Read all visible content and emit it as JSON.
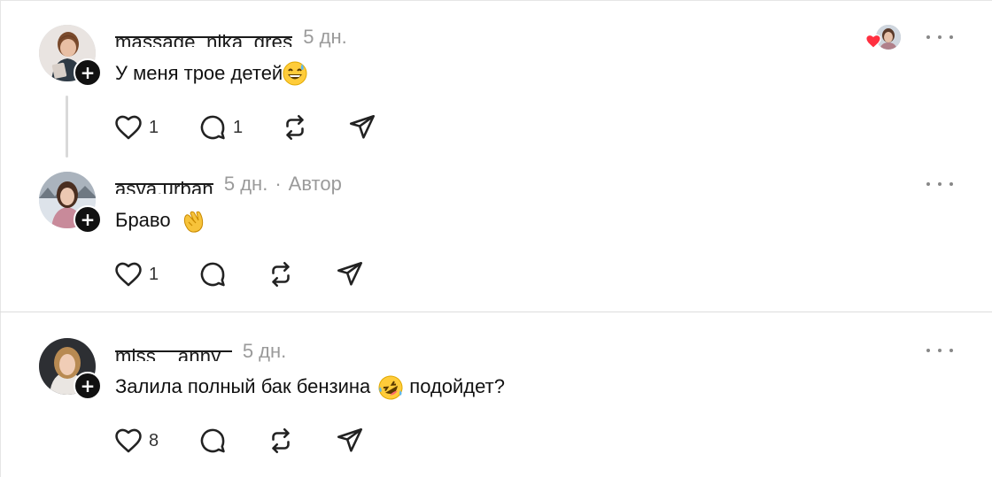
{
  "comments": [
    {
      "username": "massage_nika_gres",
      "time": "5 дн.",
      "author_label": "",
      "text": "У меня трое детей",
      "emoji": "grinning-sweat",
      "text_after": "",
      "likes": "1",
      "replies": "1",
      "liked_by_author": true
    },
    {
      "username": "asya.urban",
      "time": "5 дн.",
      "author_label": "Автор",
      "text": "Браво",
      "emoji": "clapping-hands",
      "text_after": "",
      "likes": "1",
      "replies": ""
    },
    {
      "username": "miss__anny_",
      "time": "5 дн.",
      "author_label": "",
      "text": "Залила полный бак бензина",
      "emoji": "rolling-on-floor-laughing",
      "text_after": "подойдет?",
      "likes": "8",
      "replies": ""
    }
  ],
  "separator_dot": "·",
  "follow_symbol": "+",
  "colors": {
    "text": "#111111",
    "muted": "#9a9a9a",
    "heart": "#ff3040",
    "badge": "#111111"
  }
}
